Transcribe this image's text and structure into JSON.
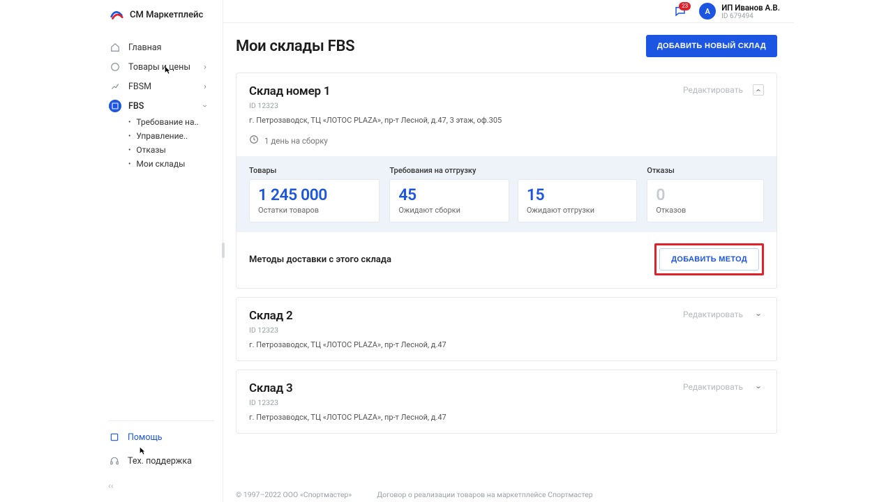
{
  "brand": {
    "name": "СМ Маркетплейс"
  },
  "notifications": {
    "count": "23"
  },
  "user": {
    "name": "ИП Иванов А.В.",
    "id_label": "ID 679494",
    "initial": "A"
  },
  "sidebar": {
    "items": [
      {
        "label": "Главная"
      },
      {
        "label": "Товары и цены"
      },
      {
        "label": "FBSM"
      },
      {
        "label": "FBS"
      }
    ],
    "fbs_sub": [
      {
        "label": "Требование на.."
      },
      {
        "label": "Управление.."
      },
      {
        "label": "Отказы"
      },
      {
        "label": "Мои склады"
      }
    ],
    "help": "Помощь",
    "support": "Тех. поддержка"
  },
  "page": {
    "title": "Мои склады FBS",
    "add_warehouse": "ДОБАВИТЬ НОВЫЙ СКЛАД"
  },
  "labels": {
    "edit": "Редактировать",
    "tovary": "Товары",
    "trebovania": "Требования на отгрузку",
    "otkazy": "Отказы",
    "methods": "Методы доставки с этого склада",
    "add_method": "ДОБАВИТЬ МЕТОД"
  },
  "warehouses": [
    {
      "title": "Склад номер 1",
      "id": "ID 12323",
      "address": "г. Петрозаводск, ТЦ «ЛОТОС PLAZA», пр-т Лесной, д.47, 3 этаж, оф.305",
      "assembly": "1 день на сборку",
      "stats": {
        "remains_val": "1 245 000",
        "remains_sub": "Остатки товаров",
        "awaiting_build_val": "45",
        "awaiting_build_sub": "Ожидают сборки",
        "awaiting_ship_val": "15",
        "awaiting_ship_sub": "Ожидают отгрузки",
        "refuse_val": "0",
        "refuse_sub": "Отказов"
      }
    },
    {
      "title": "Склад 2",
      "id": "ID 12323",
      "address": "г. Петрозаводск, ТЦ «ЛОТОС PLAZA», пр-т Лесной, д.47"
    },
    {
      "title": "Склад 3",
      "id": "ID 12323",
      "address": "г. Петрозаводск, ТЦ «ЛОТОС PLAZA», пр-т Лесной, д.47"
    }
  ],
  "footer": {
    "copyright": "© 1997–2022 ООО «Спортмастер»",
    "contract": "Договор о реализации товаров на маркетплейсе Спортмастер"
  }
}
